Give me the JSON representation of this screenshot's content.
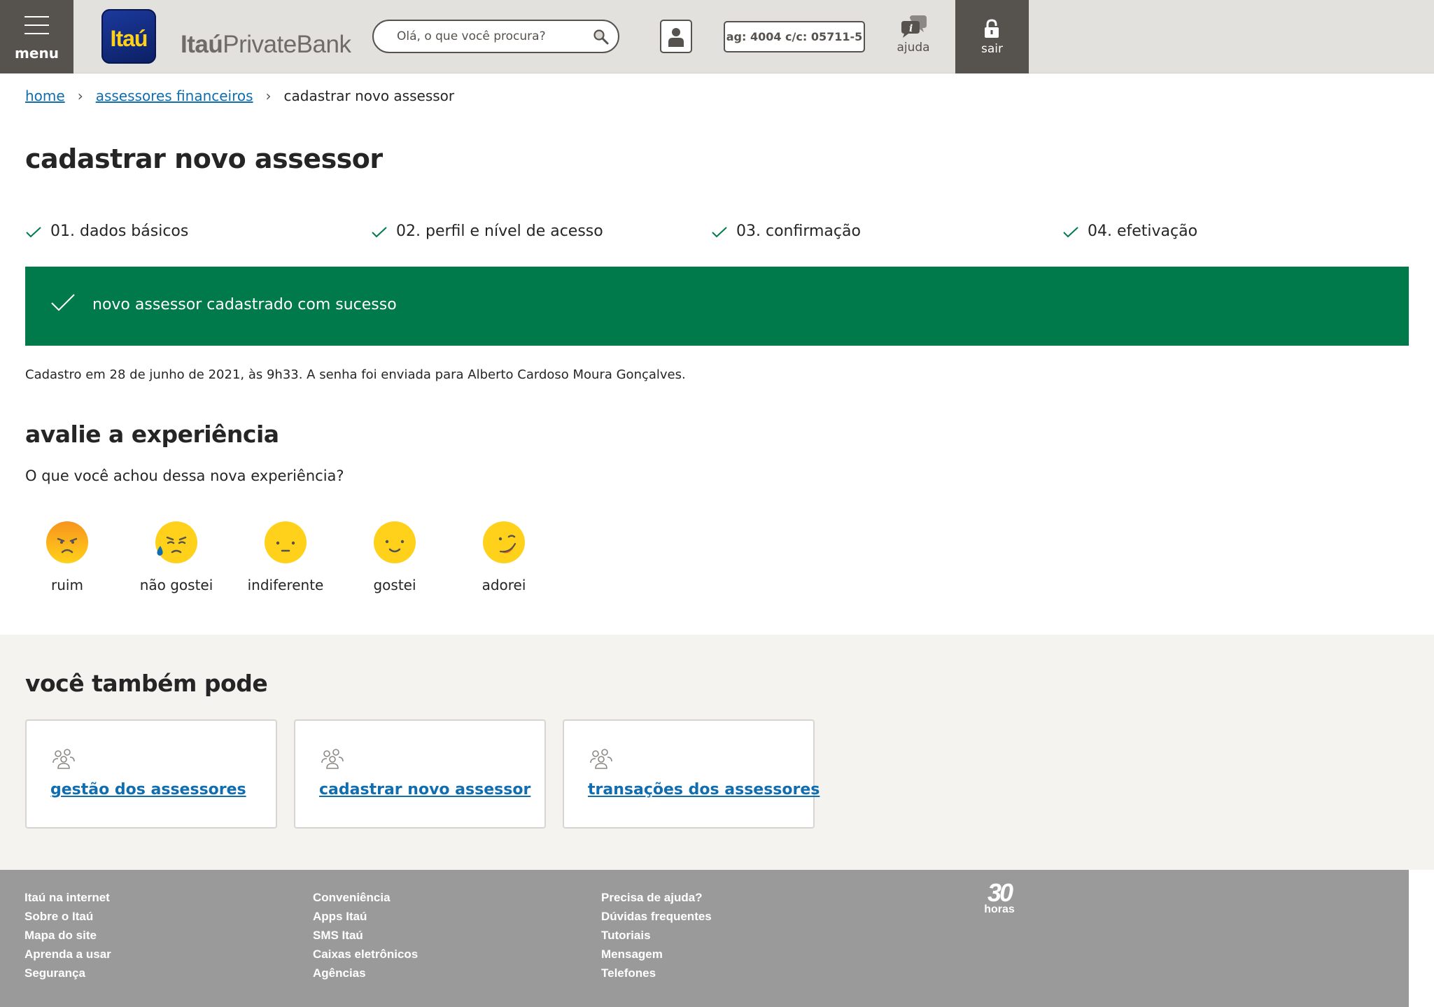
{
  "header": {
    "menu_label": "menu",
    "logo_text": "Itaú",
    "brand_bold": "Itaú",
    "brand_regular": "PrivateBank",
    "search_placeholder": "Olá, o que você procura?",
    "account": "ag: 4004 c/c: 05711-5",
    "help_label": "ajuda",
    "exit_label": "sair"
  },
  "breadcrumb": {
    "items": [
      "home",
      "assessores financeiros"
    ],
    "current": "cadastrar novo assessor"
  },
  "page_title": "cadastrar novo assessor",
  "steps": [
    "01. dados básicos",
    "02. perfil e nível de acesso",
    "03. confirmação",
    "04. efetivação"
  ],
  "banner": {
    "message": "novo assessor cadastrado com sucesso"
  },
  "info_text": "Cadastro em 28 de junho de 2021, às 9h33. A senha foi enviada para Alberto Cardoso Moura Gonçalves.",
  "rating": {
    "title": "avalie a experiência",
    "question": "O que você achou dessa nova experiência?",
    "options": [
      "ruim",
      "não gostei",
      "indiferente",
      "gostei",
      "adorei"
    ]
  },
  "also": {
    "title": "você também pode",
    "cards": [
      "gestão dos assessores",
      "cadastrar novo assessor",
      "transações dos assessores"
    ]
  },
  "footer": {
    "col1": [
      "Itaú na internet",
      "Sobre o Itaú",
      "Mapa do site",
      "Aprenda a usar",
      "Segurança"
    ],
    "col2": [
      "Conveniência",
      "Apps Itaú",
      "SMS Itaú",
      "Caixas eletrônicos",
      "Agências"
    ],
    "col3": [
      "Precisa de ajuda?",
      "Dúvidas frequentes",
      "Tutoriais",
      "Mensagem",
      "Telefones"
    ],
    "badge_number": "30",
    "badge_text": "horas"
  },
  "colors": {
    "success": "#007a4b",
    "link": "#106eb0",
    "header_dark": "#56524e",
    "footer_bg": "#9a9a9a"
  },
  "icons": [
    "menu-icon",
    "search-icon",
    "user-icon",
    "help-icon",
    "lock-icon",
    "check-icon",
    "people-icon"
  ]
}
